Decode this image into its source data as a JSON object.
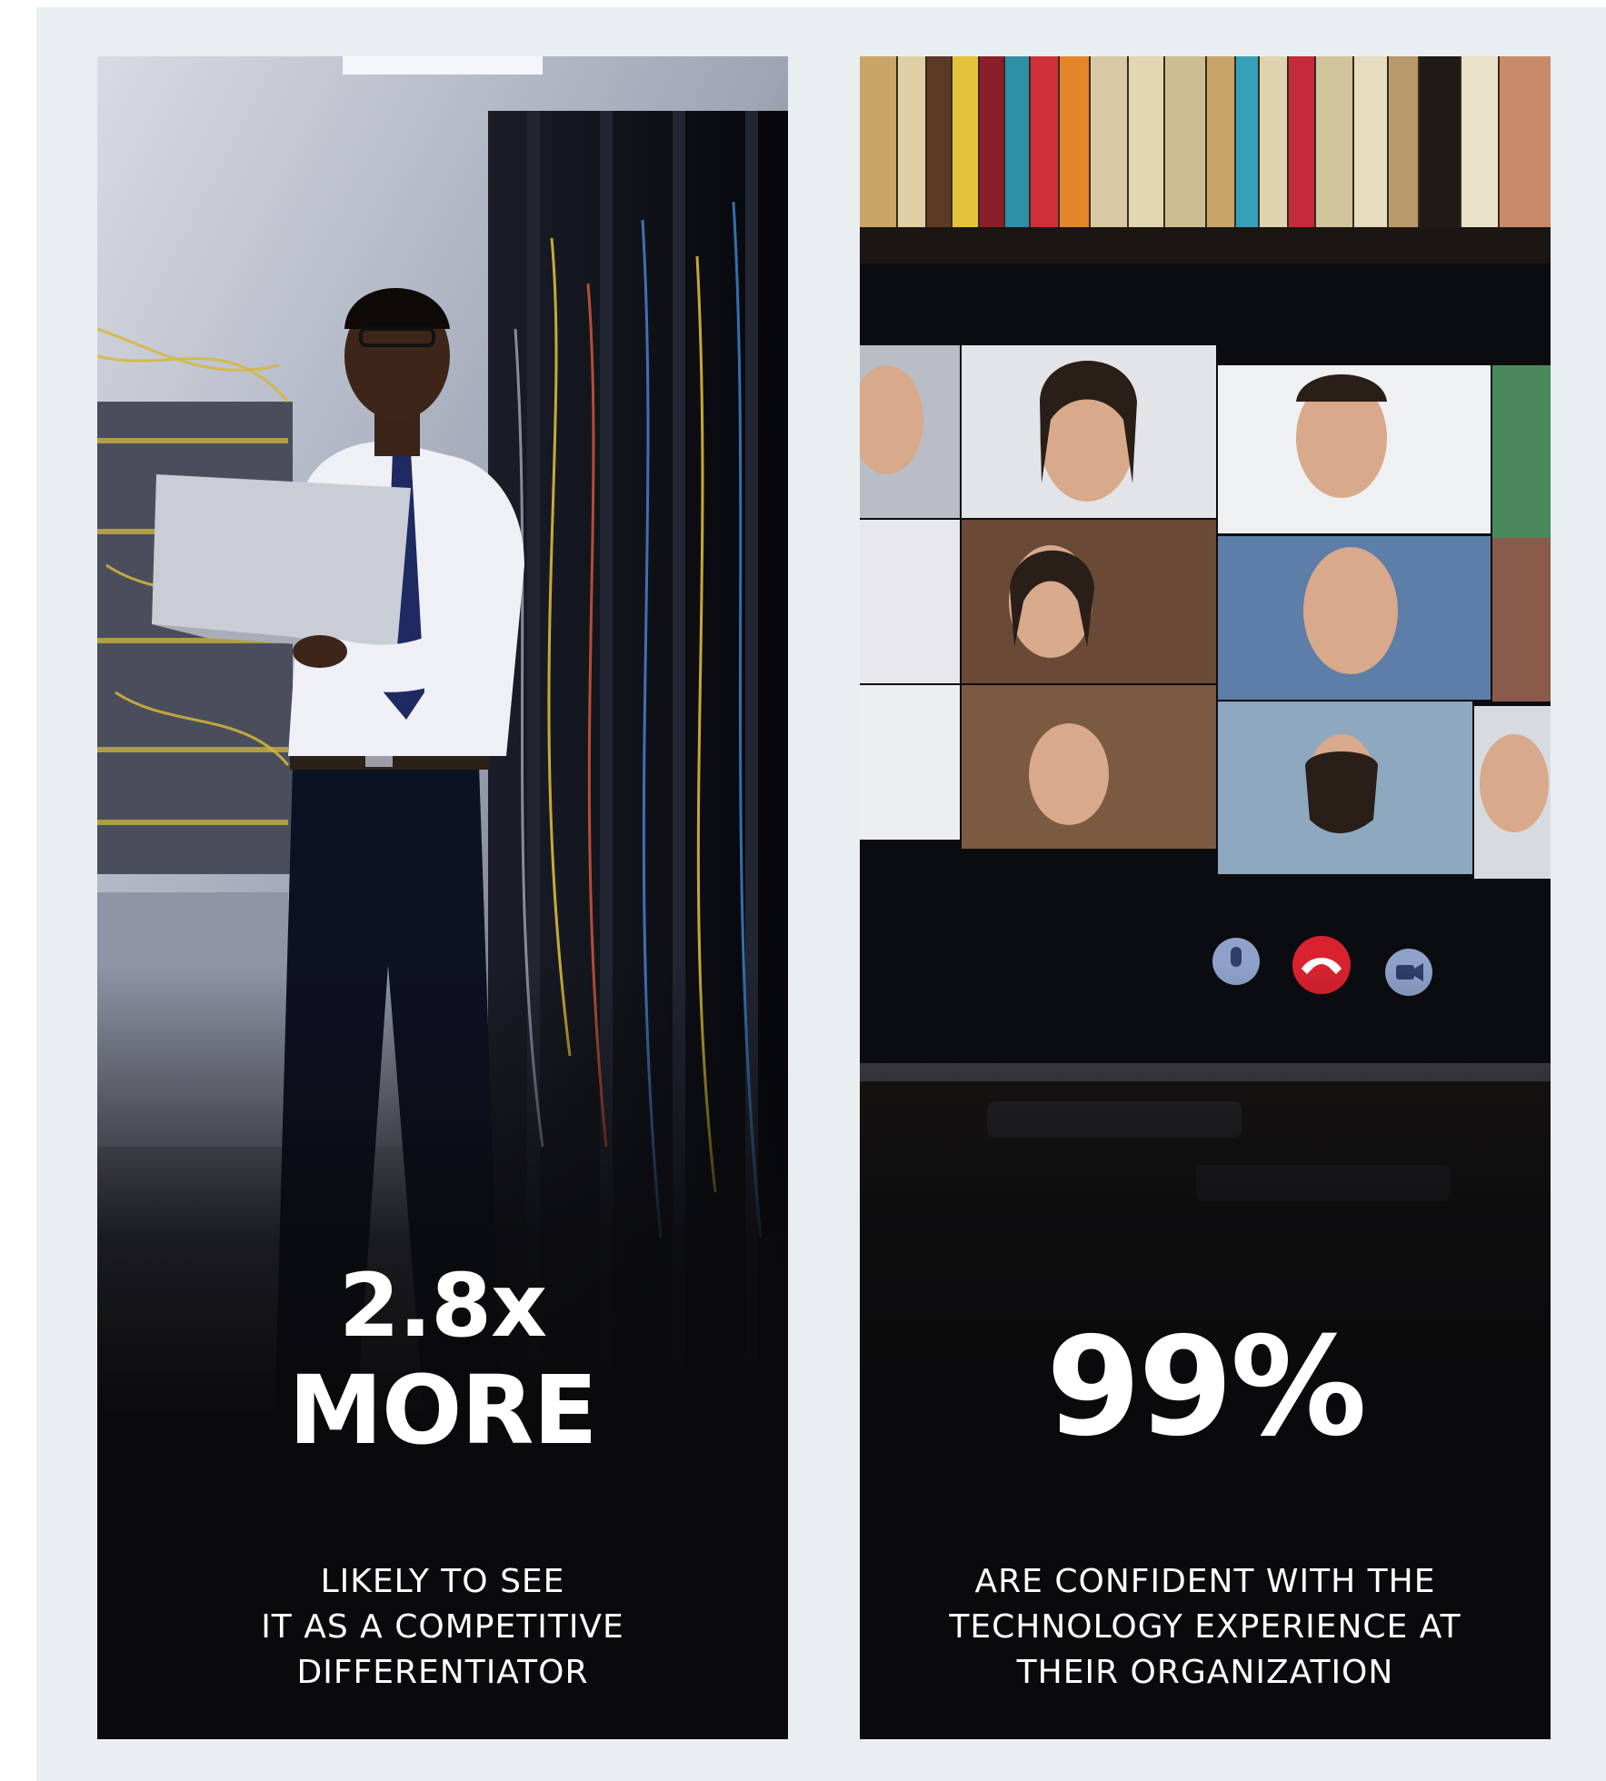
{
  "panels": [
    {
      "photo": "server-room-technician-photo",
      "stat_line1": "2.8x",
      "stat_line2": "MORE",
      "caption_lines": [
        "LIKELY TO SEE",
        "IT AS A COMPETITIVE",
        "DIFFERENTIATOR"
      ]
    },
    {
      "photo": "video-conference-screen-photo",
      "stat": "99%",
      "caption_lines": [
        "ARE CONFIDENT WITH THE",
        "TECHNOLOGY EXPERIENCE AT",
        "THEIR ORGANIZATION"
      ]
    }
  ],
  "colors": {
    "background": "#e9eef0",
    "card": "#0a0a0c",
    "text": "#ffffff",
    "end_call": "#d9222f"
  }
}
